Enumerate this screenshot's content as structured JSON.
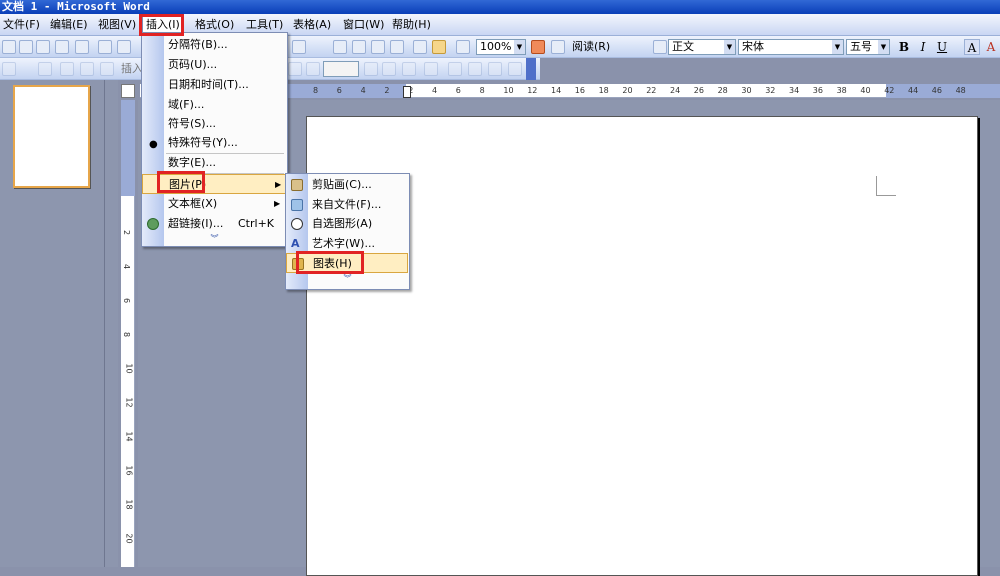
{
  "window": {
    "title": "文档 1 - Microsoft Word"
  },
  "menubar": {
    "items": [
      {
        "label": "文件(F)"
      },
      {
        "label": "编辑(E)"
      },
      {
        "label": "视图(V)"
      },
      {
        "label": "插入(I)"
      },
      {
        "label": "格式(O)"
      },
      {
        "label": "工具(T)"
      },
      {
        "label": "表格(A)"
      },
      {
        "label": "窗口(W)"
      },
      {
        "label": "帮助(H)"
      }
    ]
  },
  "toolbar": {
    "zoom": "100%",
    "read_label": "阅读(R)",
    "style": "正文",
    "font": "宋体",
    "size": "五号",
    "bold": "B",
    "italic": "I",
    "underline": "U",
    "font_color": "A",
    "insert_label": "插入"
  },
  "insert_menu": {
    "items": [
      {
        "label": "分隔符(B)..."
      },
      {
        "label": "页码(U)..."
      },
      {
        "label": "日期和时间(T)..."
      },
      {
        "label": "域(F)..."
      },
      {
        "label": "符号(S)..."
      },
      {
        "label": "特殊符号(Y)..."
      },
      {
        "label": "数字(E)..."
      },
      {
        "label": "图片(P)"
      },
      {
        "label": "文本框(X)"
      },
      {
        "label": "超链接(I)...",
        "shortcut": "Ctrl+K"
      }
    ]
  },
  "picture_menu": {
    "items": [
      {
        "label": "剪贴画(C)..."
      },
      {
        "label": "来自文件(F)..."
      },
      {
        "label": "自选图形(A)"
      },
      {
        "label": "艺术字(W)..."
      },
      {
        "label": "图表(H)"
      }
    ]
  },
  "ruler": {
    "h_ticks": [
      "8",
      "6",
      "4",
      "2",
      "2",
      "4",
      "6",
      "8",
      "10",
      "12",
      "14",
      "16",
      "18",
      "20",
      "22",
      "24",
      "26",
      "28",
      "30",
      "32",
      "34",
      "36",
      "38",
      "40",
      "42",
      "44",
      "46",
      "48"
    ],
    "v_ticks": [
      "2",
      "4",
      "6",
      "8",
      "10",
      "12",
      "14",
      "16",
      "18",
      "20"
    ]
  },
  "colors": {
    "highlight": "#e12323",
    "menu_hover": "#ffeec2",
    "titlebar": "#0a3fb8"
  }
}
